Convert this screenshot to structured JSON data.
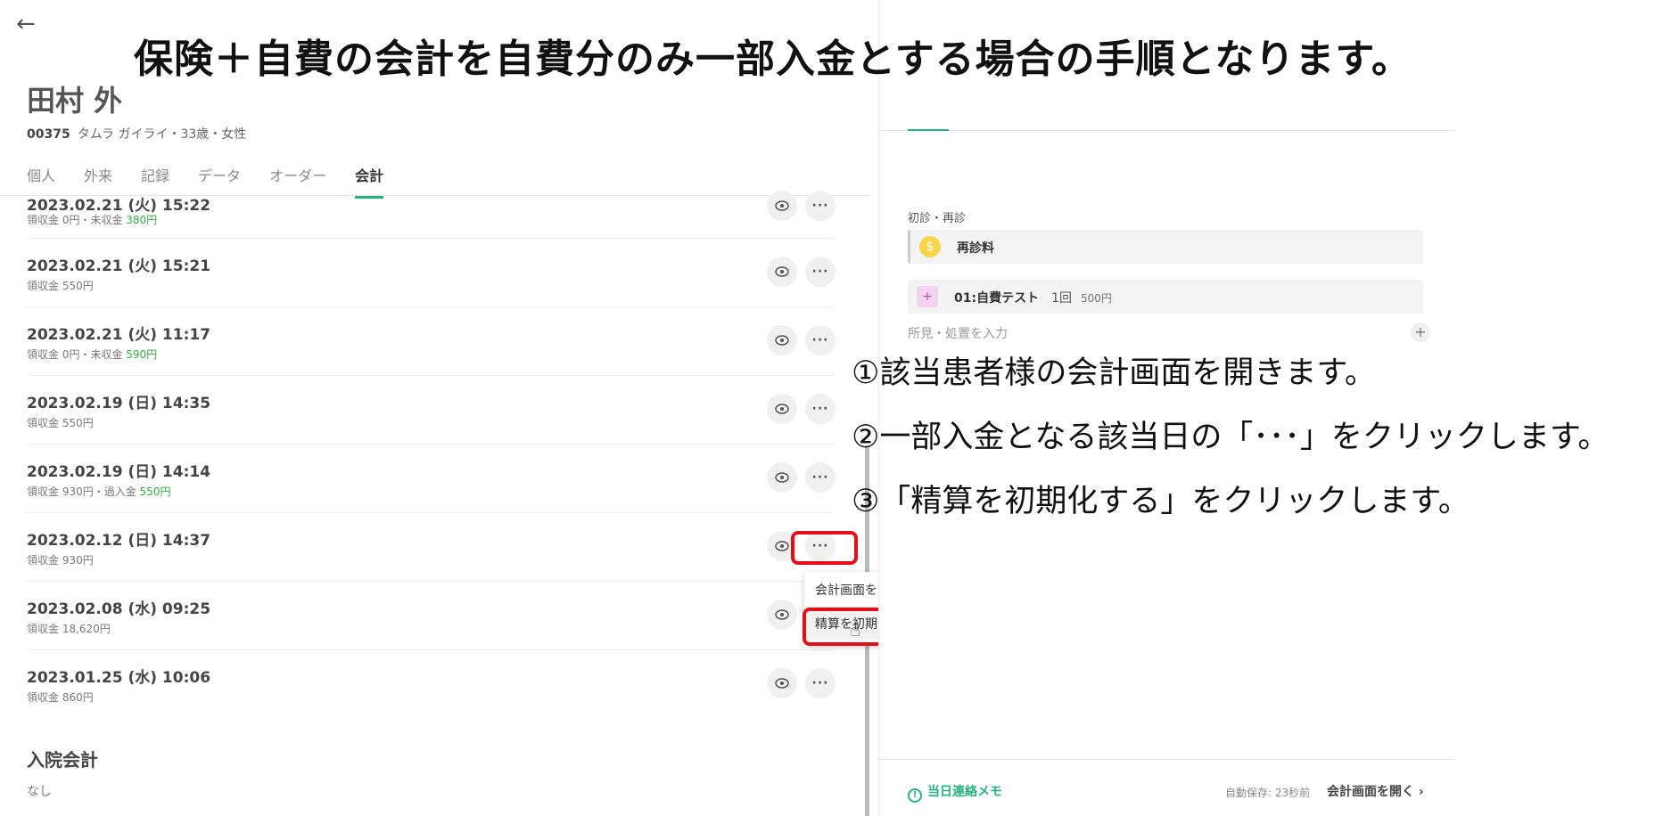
{
  "headline": "保険＋自費の会計を自費分のみ一部入金とする場合の手順となります。",
  "steps": [
    "①該当患者様の会計画面を開きます。",
    "②一部入金となる該当日の「･･･」をクリックします。",
    "③「精算を初期化する」をクリックします。"
  ],
  "patient": {
    "name": "田村 外",
    "id": "00375",
    "meta": "タムラ ガイライ・33歳・女性"
  },
  "tabs": [
    "個人",
    "外来",
    "記録",
    "データ",
    "オーダー",
    "会計"
  ],
  "records": [
    {
      "date": "2023.02.21 (火) 15:22",
      "sub_prefix": "領収金 0円・未収金 ",
      "sub_green": "380円"
    },
    {
      "date": "2023.02.21 (火) 15:21",
      "sub_prefix": "領収金 550円",
      "sub_green": ""
    },
    {
      "date": "2023.02.21 (火) 11:17",
      "sub_prefix": "領収金 0円・未収金 ",
      "sub_green": "590円"
    },
    {
      "date": "2023.02.19 (日) 14:35",
      "sub_prefix": "領収金 550円",
      "sub_green": ""
    },
    {
      "date": "2023.02.19 (日) 14:14",
      "sub_prefix": "領収金 930円・過入金 ",
      "sub_green": "550円"
    },
    {
      "date": "2023.02.12 (日) 14:37",
      "sub_prefix": "領収金 930円",
      "sub_green": ""
    },
    {
      "date": "2023.02.08 (水) 09:25",
      "sub_prefix": "領収金 18,620円",
      "sub_green": ""
    },
    {
      "date": "2023.01.25 (水) 10:06",
      "sub_prefix": "領収金 860円",
      "sub_green": ""
    }
  ],
  "more_glyph": "···",
  "inpatient": {
    "title": "入院会計",
    "none": "なし"
  },
  "context_menu": {
    "open": "会計画面を開く",
    "reset": "精算を初期化する..."
  },
  "right_panel": {
    "section": "初診・再診",
    "item1": {
      "name": "再診料",
      "icon": "$"
    },
    "item2": {
      "name": "01:自費テスト",
      "qty": "1回",
      "price": "500円",
      "icon": "+"
    },
    "finding": "所見・処置を入力",
    "plus": "+",
    "memo": "当日連絡メモ",
    "memo_icon": "!",
    "autosave": "自動保存: 23秒前",
    "open_link": "会計画面を開く ›"
  },
  "back_glyph": "←"
}
